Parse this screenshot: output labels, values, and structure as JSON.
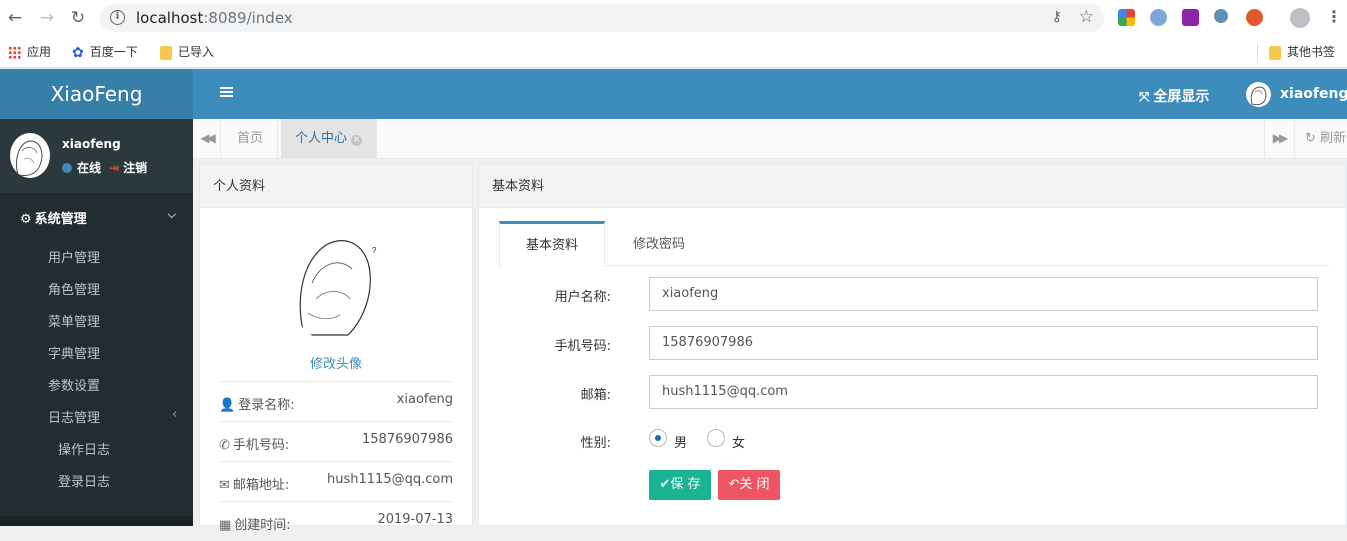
{
  "browser": {
    "url_host": "localhost",
    "url_rest": ":8089/index",
    "bookmarks": [
      "应用",
      "百度一下",
      "已导入"
    ],
    "other_bookmarks": "其他书签"
  },
  "header": {
    "logo": "XiaoFeng",
    "fullscreen": "全屏显示",
    "username": "xiaofeng"
  },
  "sidebar": {
    "user_name": "xiaofeng",
    "status": "在线",
    "logout": "注销",
    "menu_title": "系统管理",
    "items": [
      "用户管理",
      "角色管理",
      "菜单管理",
      "字典管理",
      "参数设置",
      "日志管理"
    ],
    "sub_items": [
      "操作日志",
      "登录日志"
    ]
  },
  "tabs": {
    "items": [
      "首页",
      "个人中心"
    ],
    "refresh": "刷新"
  },
  "profile_box": {
    "title": "个人资料",
    "change_avatar": "修改头像",
    "rows": [
      {
        "label": "登录名称:",
        "value": "xiaofeng"
      },
      {
        "label": "手机号码:",
        "value": "15876907986"
      },
      {
        "label": "邮箱地址:",
        "value": "hush1115@qq.com"
      },
      {
        "label": "创建时间:",
        "value": "2019-07-13"
      }
    ]
  },
  "basic_box": {
    "title": "基本资料",
    "tabs": [
      "基本资料",
      "修改密码"
    ],
    "fields": {
      "username_label": "用户名称:",
      "username_value": "xiaofeng",
      "phone_label": "手机号码:",
      "phone_value": "15876907986",
      "email_label": "邮箱:",
      "email_value": "hush1115@qq.com",
      "gender_label": "性别:",
      "gender_male": "男",
      "gender_female": "女"
    },
    "save_button": "保 存",
    "close_button": "关 闭"
  }
}
